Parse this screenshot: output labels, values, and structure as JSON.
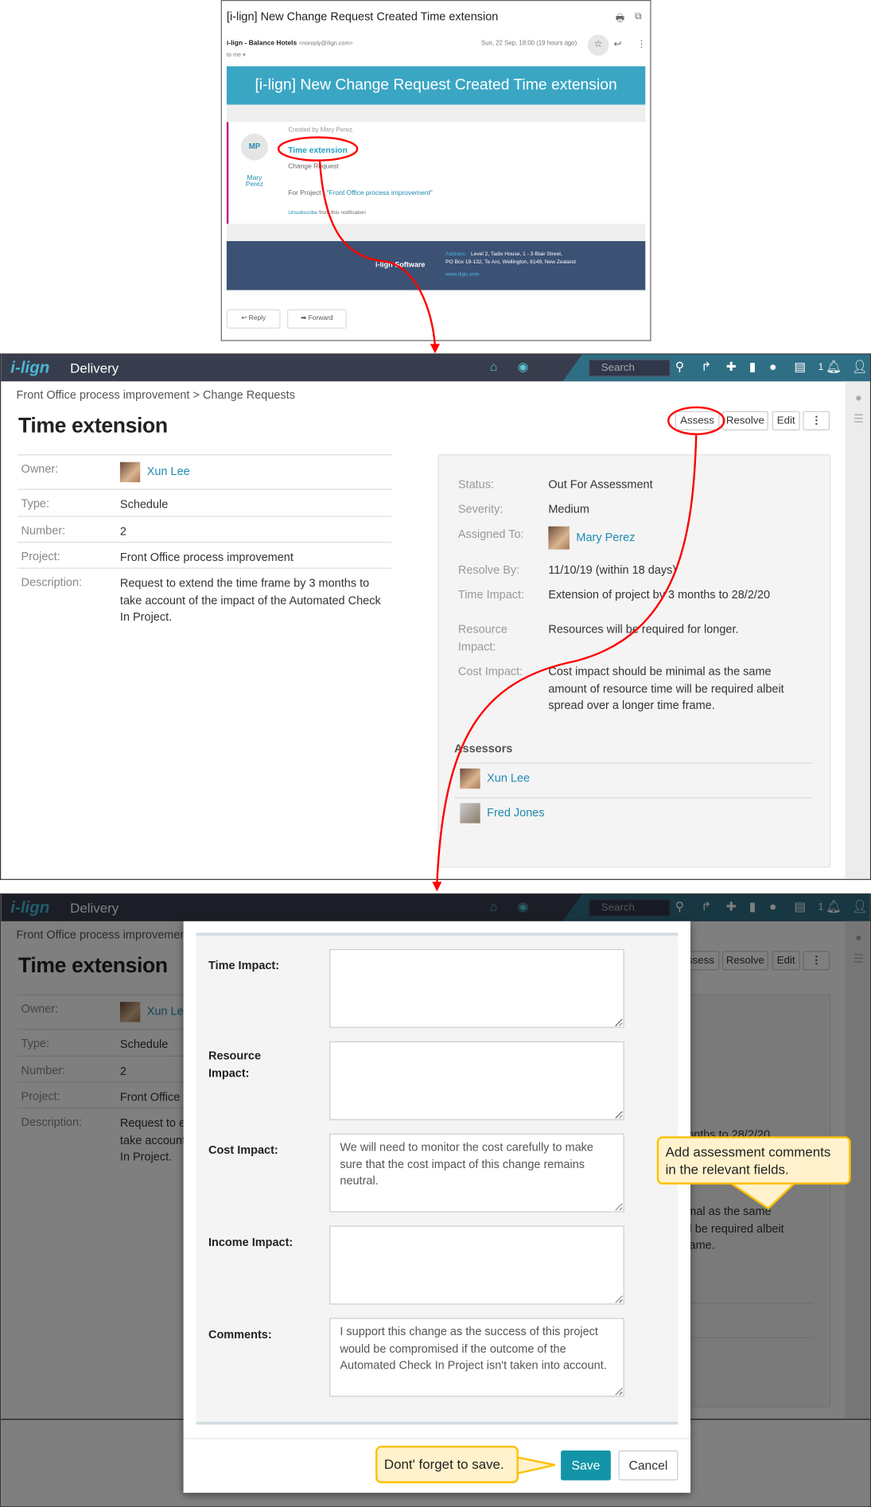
{
  "email": {
    "subject": "[i-lign] New Change Request Created Time extension",
    "sender": "i-lign - Balance Hotels",
    "sender_address": "<noreply@ilign.com>",
    "to": "to me",
    "date": "Sun, 22 Sep, 18:00 (19 hours ago)",
    "banner": "[i-lign] New Change Request Created Time extension",
    "avatar_initials": "MP",
    "creator_name": "Mary Perez",
    "created_by": "Created by Mary Perez.",
    "item_title": "Time extension",
    "item_type": "Change Request",
    "for_project_label": "For Project :",
    "for_project": "\"Front Office process improvement\"",
    "unsubscribe": "Unsubscribe",
    "unsubscribe_rest": "from this notification",
    "footer_company": "i-lign Software",
    "footer_address_label": "Address:",
    "footer_address_1": "Level 2, Tadix House, 1 - 3 Blair Street,",
    "footer_address_2": "PO Box 19-132, Te Aro, Wellington, 6149, New Zealand",
    "footer_url": "www.ilign.com",
    "reply": "Reply",
    "forward": "Forward"
  },
  "app": {
    "logo": "i-lign",
    "name": "Delivery",
    "search_placeholder": "Search",
    "notification_count": "1",
    "breadcrumb": "Front Office process improvement > Change Requests",
    "title": "Time extension",
    "buttons": {
      "assess": "Assess",
      "resolve": "Resolve",
      "edit": "Edit"
    },
    "details": [
      {
        "label": "Owner:",
        "value": "Xun Lee"
      },
      {
        "label": "Type:",
        "value": "Schedule"
      },
      {
        "label": "Number:",
        "value": "2"
      },
      {
        "label": "Project:",
        "value": "Front Office process improvement"
      },
      {
        "label": "Description:",
        "value": "Request to extend the time frame by 3 months to take account of the impact of the Automated Check In Project."
      }
    ],
    "status": [
      {
        "label": "Status:",
        "value": "Out For Assessment"
      },
      {
        "label": "Severity:",
        "value": "Medium"
      },
      {
        "label": "Assigned To:",
        "value": "Mary Perez"
      },
      {
        "label": "Resolve By:",
        "value": "11/10/19 (within 18 days)"
      },
      {
        "label": "Time Impact:",
        "value": "Extension of project by 3 months to 28/2/20"
      },
      {
        "label": "Resource Impact:",
        "value": "Resources will be required for longer."
      },
      {
        "label": "Cost Impact:",
        "value": "Cost impact should be minimal as the same amount of resource time will be required albeit spread over a longer time frame."
      }
    ],
    "assessors_heading": "Assessors",
    "assessors": [
      "Xun Lee",
      "Fred Jones"
    ]
  },
  "modal": {
    "fields": [
      {
        "label": "Time Impact:",
        "value": ""
      },
      {
        "label": "Resource Impact:",
        "value": ""
      },
      {
        "label": "Cost Impact:",
        "value": "We will need to monitor the cost carefully to make sure that the cost impact of this change remains neutral."
      },
      {
        "label": "Income Impact:",
        "value": ""
      },
      {
        "label": "Comments:",
        "value": "I support this change as the success of this project would be compromised if the outcome of the Automated Check In Project isn't taken into account."
      }
    ],
    "save": "Save",
    "cancel": "Cancel"
  },
  "callouts": {
    "assessment": "Add assessment comments in the relevant fields.",
    "save": "Dont' forget to save."
  },
  "colors": {
    "accent": "#1394a8",
    "annotation": "#ff0000",
    "callout_bg": "#fff2cc",
    "callout_border": "#ffc000",
    "email_banner": "#3aa6c3",
    "email_footer": "#3b5275"
  }
}
